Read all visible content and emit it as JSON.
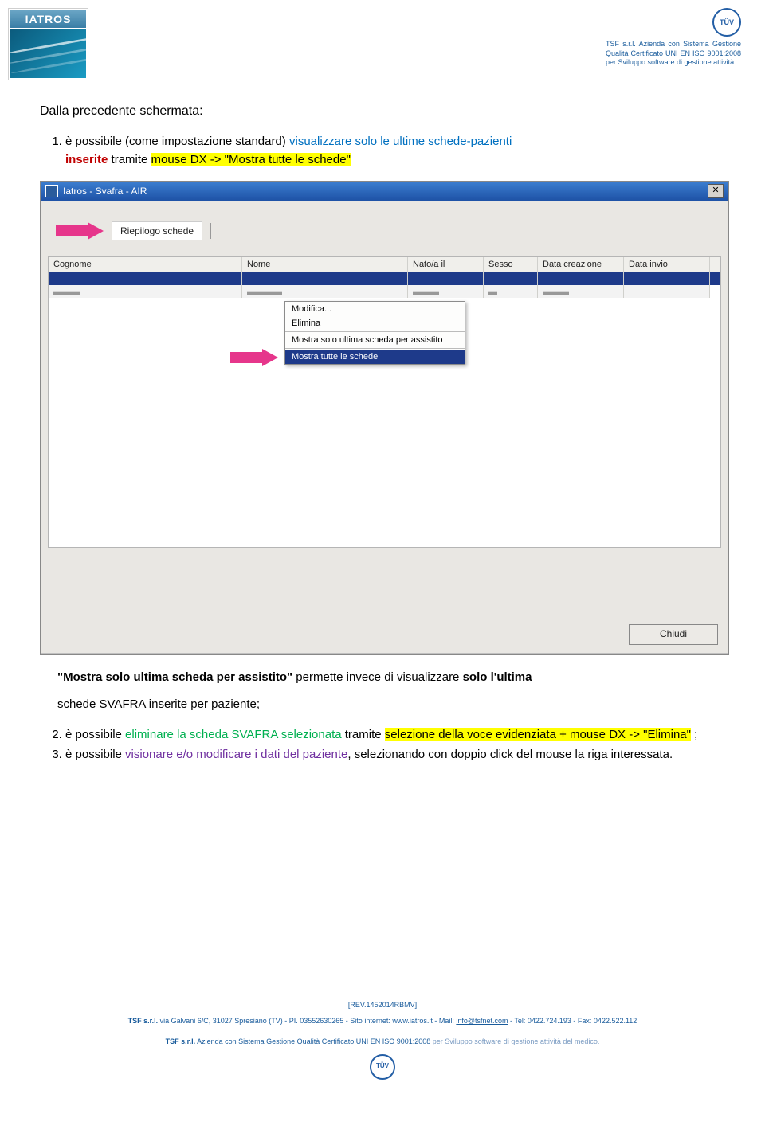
{
  "header": {
    "logo_text": "IATROS",
    "cert_text": "TSF s.r.l. Azienda con Sistema Gestione Qualità Certificato UNI EN ISO 9001:2008 per Sviluppo software di gestione attività",
    "tuv": "TÜV"
  },
  "content": {
    "heading": "Dalla precedente schermata:",
    "step1_pre": "è possibile  (come impostazione standard) ",
    "step1_vis": "visualizzare solo le ultime schede-pazienti",
    "step1_ins_red": "inserite",
    "step1_ins_rest": " tramite ",
    "step1_hl": "mouse DX -> \"Mostra tutte le schede\"",
    "quote_title": "\"Mostra solo ultima scheda per assistito\"",
    "quote_rest": " permette invece di visualizzare ",
    "quote_bold": "solo l'ultima",
    "quote_tail": " schede SVAFRA inserite per paziente;",
    "step2_pre": "è possibile  ",
    "step2_green": "eliminare la scheda SVAFRA selezionata",
    "step2_mid": " tramite ",
    "step2_hl": "selezione della voce evidenziata + mouse DX -> \"Elimina\"",
    "step2_tail": " ;",
    "step3_pre": "è possibile  ",
    "step3_viol": "visionare e/o modificare i dati del paziente",
    "step3_tail": ", selezionando con doppio click del mouse la riga interessata."
  },
  "app": {
    "title": "Iatros - Svafra - AIR",
    "riepilogo": "Riepilogo schede",
    "columns": {
      "cognome": "Cognome",
      "nome": "Nome",
      "nato": "Nato/a il",
      "sesso": "Sesso",
      "data_creazione": "Data creazione",
      "data_invio": "Data invio"
    },
    "context_menu": {
      "modifica": "Modifica...",
      "elimina": "Elimina",
      "mostra_ultima": "Mostra solo ultima scheda per assistito",
      "mostra_tutte": "Mostra tutte le schede"
    },
    "chiudi": "Chiudi"
  },
  "footer": {
    "rev": "[REV.1452014RBMV]",
    "line1_a": "TSF s.r.l.",
    "line1_b": " via Galvani 6/C, 31027 Spresiano (TV) - PI. 03552630265  - Sito internet: www.iatros.it - Mail: ",
    "line1_mail": "info@tsfnet.com",
    "line1_c": " - Tel: 0422.724.193 - Fax: 0422.522.112",
    "line2_a": "TSF s.r.l.",
    "line2_b": " Azienda con Sistema Gestione Qualità Certificato UNI EN ISO 9001:2008 ",
    "line2_c": "per Sviluppo software di gestione attività del medico."
  }
}
